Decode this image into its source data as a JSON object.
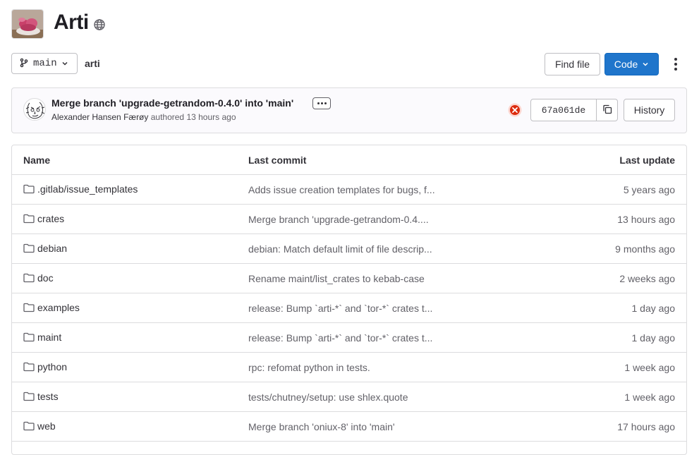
{
  "project": {
    "title": "Arti",
    "visibility_icon": "globe-icon"
  },
  "branch": {
    "name": "main",
    "branch_icon": "branch-icon",
    "dropdown_icon": "chevron-down-icon"
  },
  "breadcrumb": "arti",
  "actions": {
    "find_file": "Find file",
    "code": "Code",
    "more_icon": "kebab-icon"
  },
  "last_commit": {
    "title": "Merge branch 'upgrade-getrandom-0.4.0' into 'main'",
    "author": "Alexander Hansen Færøy",
    "authored_label": "authored",
    "time": "13 hours ago",
    "pipeline_status": "failed",
    "sha": "67a061de",
    "history": "History",
    "status_color": "#dd2b0e"
  },
  "table": {
    "headers": {
      "name": "Name",
      "last_commit": "Last commit",
      "last_update": "Last update"
    },
    "rows": [
      {
        "name": ".gitlab/issue_templates",
        "message": "Adds issue creation templates for bugs, f...",
        "updated": "5 years ago"
      },
      {
        "name": "crates",
        "message": "Merge branch 'upgrade-getrandom-0.4....",
        "updated": "13 hours ago"
      },
      {
        "name": "debian",
        "message": "debian: Match default limit of file descrip...",
        "updated": "9 months ago"
      },
      {
        "name": "doc",
        "message": "Rename maint/list_crates to kebab-case",
        "updated": "2 weeks ago"
      },
      {
        "name": "examples",
        "message": "release: Bump `arti-*` and `tor-*` crates t...",
        "updated": "1 day ago"
      },
      {
        "name": "maint",
        "message": "release: Bump `arti-*` and `tor-*` crates t...",
        "updated": "1 day ago"
      },
      {
        "name": "python",
        "message": "rpc: refomat python in tests.",
        "updated": "1 week ago"
      },
      {
        "name": "tests",
        "message": "tests/chutney/setup: use shlex.quote",
        "updated": "1 week ago"
      },
      {
        "name": "web",
        "message": "Merge branch 'oniux-8' into 'main'",
        "updated": "17 hours ago"
      }
    ]
  },
  "colors": {
    "primary": "#1f75cb",
    "border": "#dcdcde",
    "text": "#333238",
    "muted": "#626168"
  }
}
